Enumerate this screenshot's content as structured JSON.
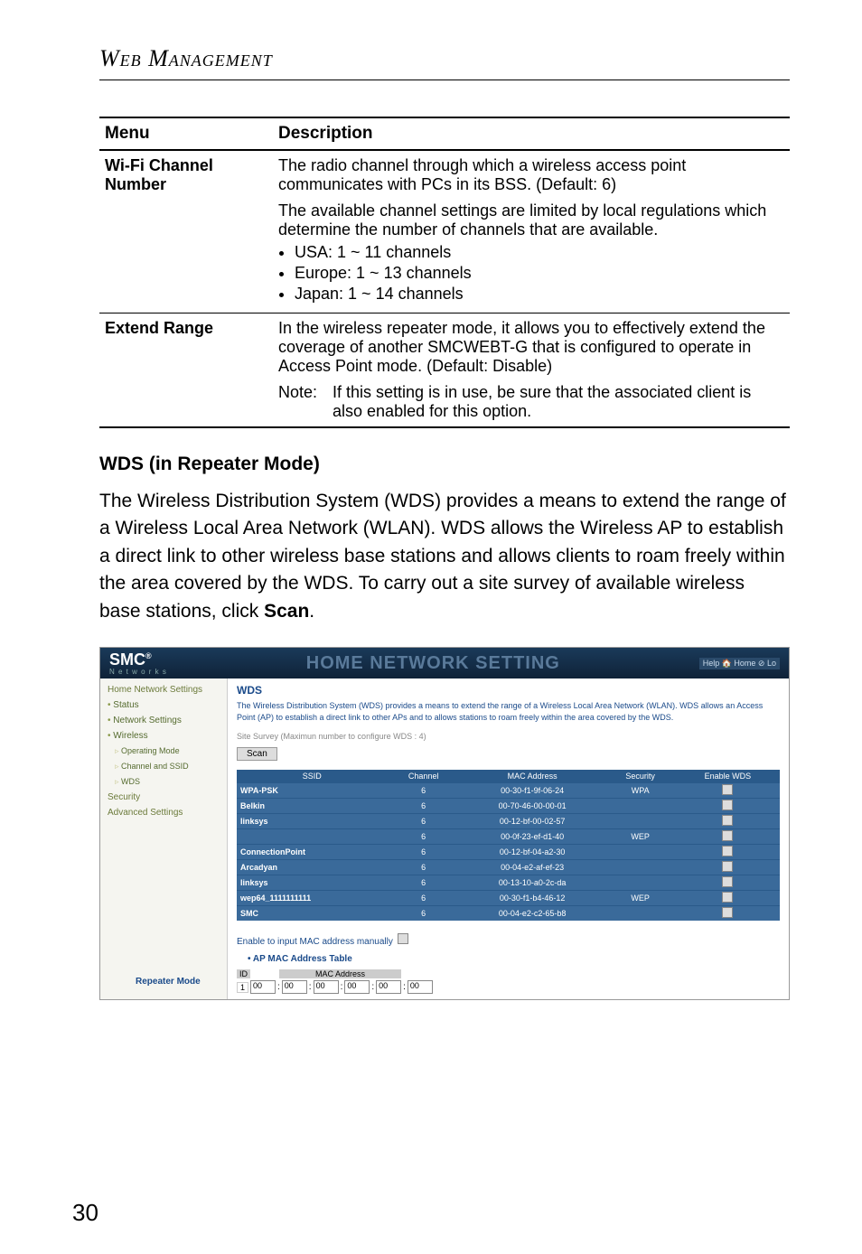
{
  "page": {
    "header": "Web Management",
    "number": "30"
  },
  "table": {
    "head": {
      "menu": "Menu",
      "desc": "Description"
    },
    "rows": [
      {
        "menu": "Wi-Fi Channel Number",
        "desc1": "The radio channel through which a wireless access point communicates with PCs in its BSS. (Default: 6)",
        "desc2": "The available channel settings are limited by local regulations which determine the number of channels that are available.",
        "bullets": [
          "USA: 1 ~ 11 channels",
          "Europe: 1 ~ 13 channels",
          "Japan: 1 ~ 14 channels"
        ]
      },
      {
        "menu": "Extend Range",
        "desc1": "In the wireless repeater mode, it allows you to effectively extend the coverage of another SMCWEBT-G that is configured to operate in Access Point mode. (Default: Disable)",
        "note_label": "Note:",
        "note": "If this setting is in use, be sure that the associated client is also enabled for this option."
      }
    ]
  },
  "section": {
    "heading": "WDS (in Repeater Mode)",
    "para_pre": "The Wireless Distribution System (WDS) provides a means to extend the range of a Wireless Local Area Network (WLAN). WDS allows the Wireless AP to establish a direct link to other wireless base stations and allows clients to roam freely within the area covered by the WDS. To carry out a site survey of available wireless base stations, click ",
    "scan": "Scan",
    "para_post": "."
  },
  "screenshot": {
    "logo": "SMC",
    "logo_sup": "®",
    "logo_sub": "N e t w o r k s",
    "title": "HOME NETWORK SETTING",
    "help": "Help 🏠 Home ⊘ Lo",
    "nav": {
      "home": "Home Network Settings",
      "items": [
        "Status",
        "Network Settings",
        "Wireless"
      ],
      "subs": [
        "Operating Mode",
        "Channel and SSID",
        "WDS"
      ],
      "security": "Security",
      "advanced": "Advanced Settings"
    },
    "main": {
      "h": "WDS",
      "desc": "The Wireless Distribution System (WDS) provides a means to extend the range of a Wireless Local Area Network (WLAN). WDS allows an Access Point (AP) to establish a direct link to other APs and to allows stations to roam freely within the area covered by the WDS.",
      "survey_label": "Site Survey ",
      "survey_note": "(Maximun number to configure WDS : 4)",
      "scan_btn": "Scan",
      "cols": [
        "SSID",
        "Channel",
        "MAC Address",
        "Security",
        "Enable WDS"
      ],
      "rows": [
        {
          "ssid": "WPA-PSK",
          "ch": "6",
          "mac": "00-30-f1-9f-06-24",
          "sec": "WPA"
        },
        {
          "ssid": "Belkin",
          "ch": "6",
          "mac": "00-70-46-00-00-01",
          "sec": ""
        },
        {
          "ssid": "linksys",
          "ch": "6",
          "mac": "00-12-bf-00-02-57",
          "sec": ""
        },
        {
          "ssid": "",
          "ch": "6",
          "mac": "00-0f-23-ef-d1-40",
          "sec": "WEP"
        },
        {
          "ssid": "ConnectionPoint",
          "ch": "6",
          "mac": "00-12-bf-04-a2-30",
          "sec": ""
        },
        {
          "ssid": "Arcadyan",
          "ch": "6",
          "mac": "00-04-e2-af-ef-23",
          "sec": ""
        },
        {
          "ssid": "linksys",
          "ch": "6",
          "mac": "00-13-10-a0-2c-da",
          "sec": ""
        },
        {
          "ssid": "wep64_1111111111",
          "ch": "6",
          "mac": "00-30-f1-b4-46-12",
          "sec": "WEP"
        },
        {
          "ssid": "SMC",
          "ch": "6",
          "mac": "00-04-e2-c2-65-b8",
          "sec": ""
        }
      ],
      "manual": "Enable to input MAC address manually",
      "ap_table": "AP MAC Address Table",
      "id_h": "ID",
      "mac_h": "MAC Address",
      "id_v": "1",
      "oct": "00",
      "repeater": "Repeater Mode"
    }
  }
}
